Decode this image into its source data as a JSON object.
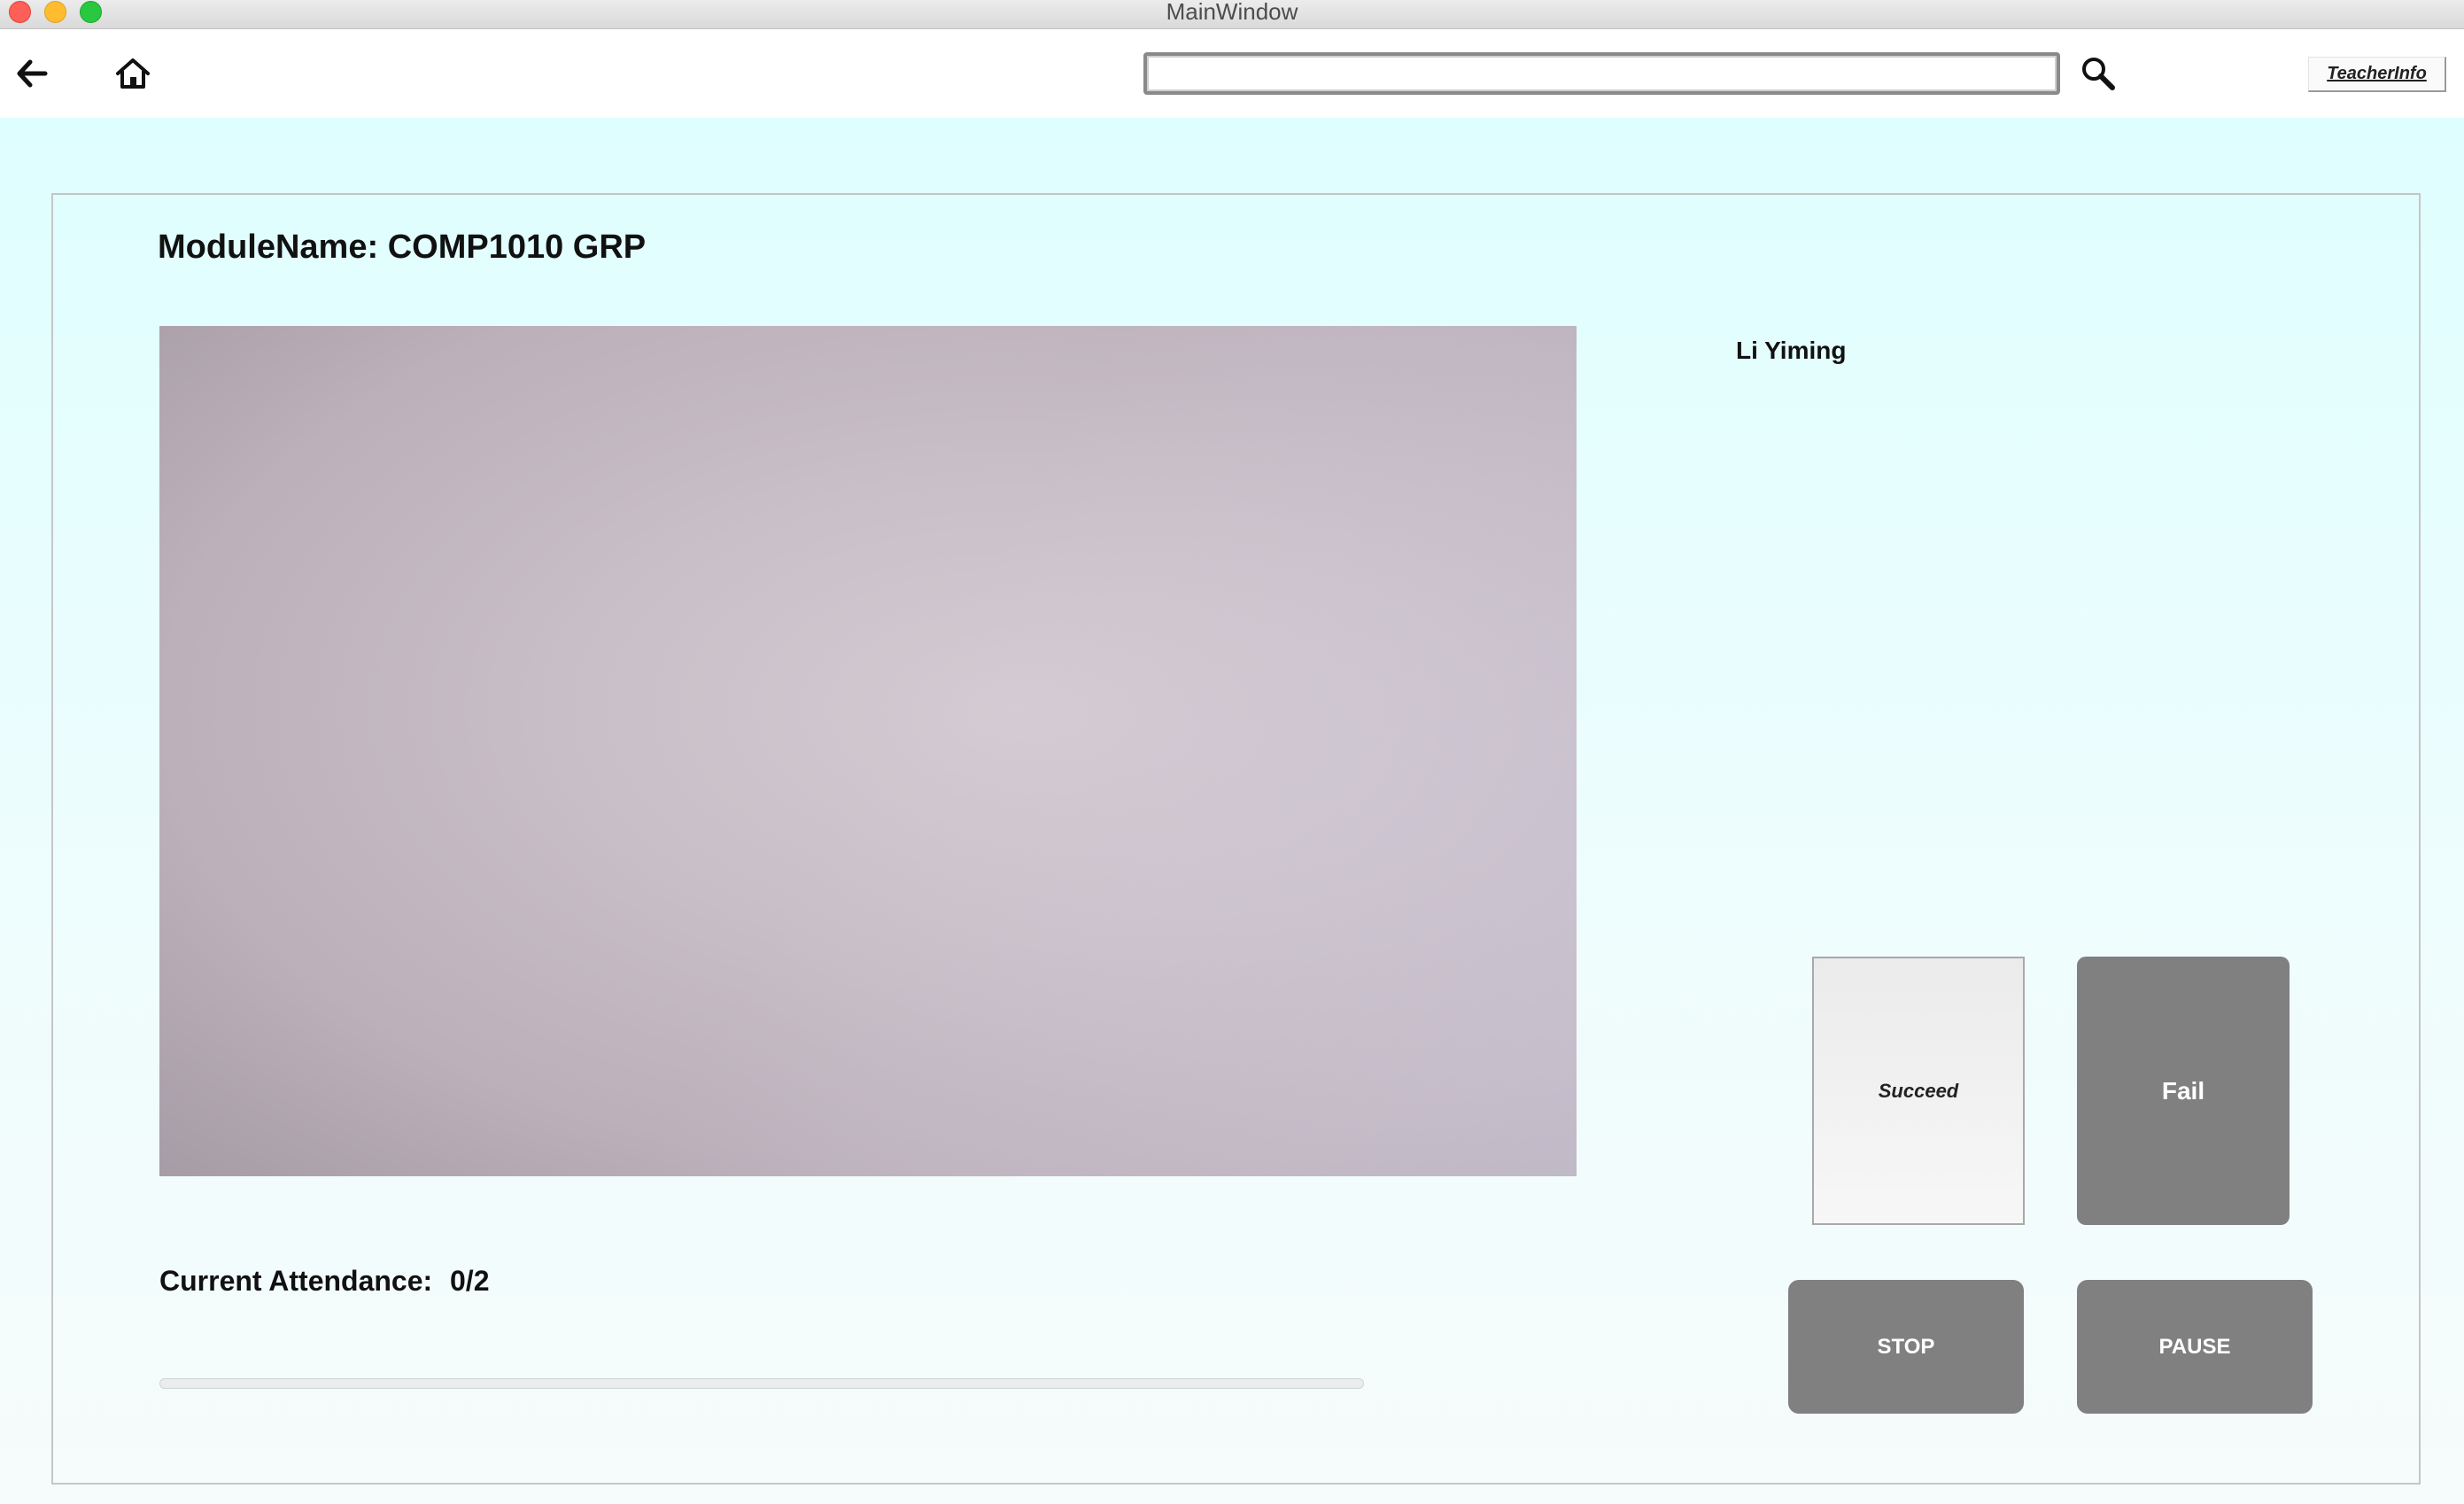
{
  "window": {
    "title": "MainWindow"
  },
  "toolbar": {
    "back_icon": "arrow-left-icon",
    "home_icon": "home-icon",
    "search": {
      "value": "",
      "placeholder": ""
    },
    "search_icon": "magnifier-icon",
    "teacher_info_label": "TeacherInfo"
  },
  "module": {
    "title": "ModuleName: COMP1010 GRP"
  },
  "camera": {
    "description_icon": "camera-feed"
  },
  "student": {
    "name": "Li Yiming"
  },
  "buttons": {
    "succeed": "Succeed",
    "fail": "Fail",
    "stop": "STOP",
    "pause": "PAUSE"
  },
  "attendance": {
    "label": "Current Attendance:",
    "value": "0/2",
    "progress_fraction": 0
  },
  "colors": {
    "background": "#dffeff",
    "button_gray": "#808080",
    "succeed_bg": "#f0f0f0"
  }
}
